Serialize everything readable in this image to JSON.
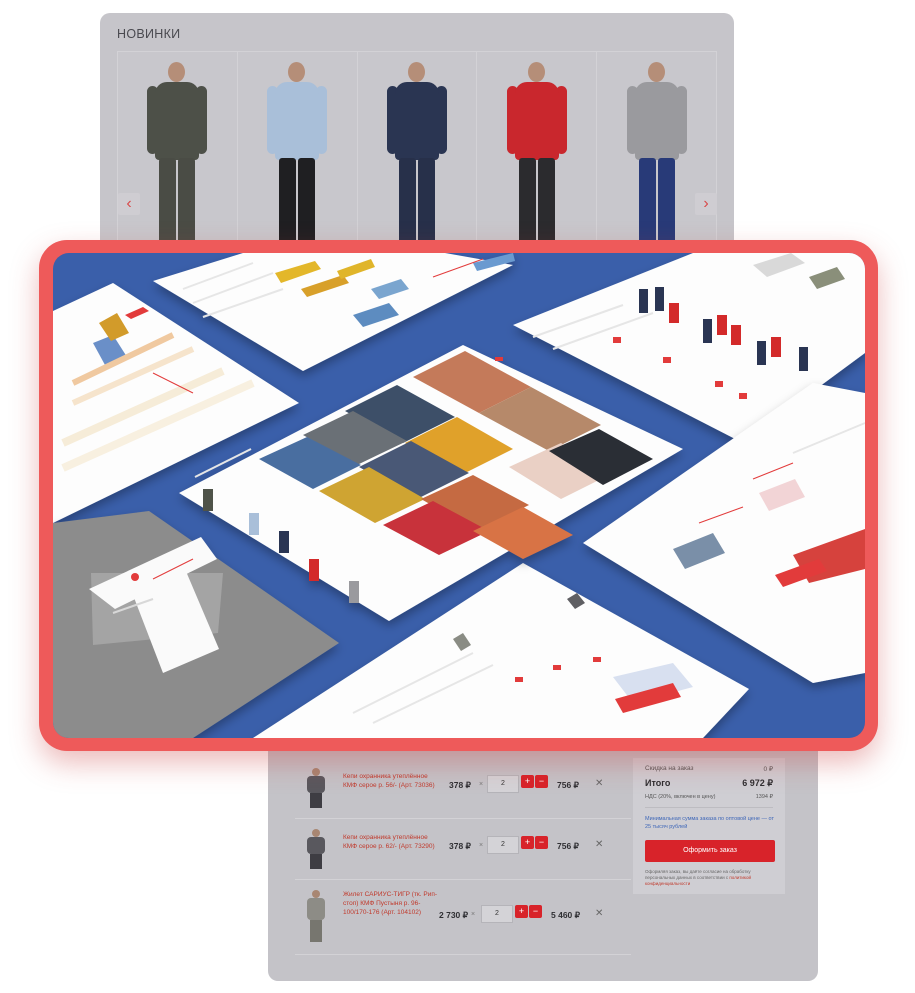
{
  "new_arrivals": {
    "title": "НОВИНКИ",
    "prev_icon": "chevron-left-icon",
    "next_icon": "chevron-right-icon",
    "products": [
      {
        "jacket": "#4d5048",
        "pants": "#4a4c45",
        "style": "camo"
      },
      {
        "jacket": "#a9bfd9",
        "pants": "#1f1f22",
        "style": "shirt"
      },
      {
        "jacket": "#2a3552",
        "pants": "#27304a",
        "style": "jacket"
      },
      {
        "jacket": "#c9272d",
        "pants": "#2b2b2e",
        "style": "jacket"
      },
      {
        "jacket": "#9a9a9e",
        "pants": "#283a78",
        "style": "tshirt"
      }
    ]
  },
  "cart": {
    "items": [
      {
        "name": "Кепи охранника утеплённое КМФ серое р. 56/- (Арт. 73036)",
        "price": "378 ₽",
        "times": "×",
        "qty": "2",
        "plus": "+",
        "minus": "−",
        "total": "756 ₽",
        "remove": "✕"
      },
      {
        "name": "Кепи охранника утеплённое КМФ серое р. 62/- (Арт. 73290)",
        "price": "378 ₽",
        "times": "×",
        "qty": "2",
        "plus": "+",
        "minus": "−",
        "total": "756 ₽",
        "remove": "✕"
      },
      {
        "name": "Жилет САРИУС-ТИГР (тк. Рип-стоп) КМФ Пустыня р. 96-100/170-176 (Арт. 104102)",
        "price": "2 730 ₽",
        "times": "×",
        "qty": "2",
        "plus": "+",
        "minus": "−",
        "total": "5 460 ₽",
        "remove": "✕"
      }
    ],
    "summary": {
      "discount_label": "Скидка на заказ",
      "discount_value": "0 ₽",
      "total_label": "Итого",
      "total_value": "6 972 ₽",
      "vat_label": "НДС (20%, включен в цену)",
      "vat_value": "1394 ₽",
      "min_sum": "Минимальная сумма заказа по оптовой цене — от 25 тысяч рублей",
      "order_button": "Оформить заказ",
      "note_prefix": "Оформляя заказ, вы даёте согласие на обработку персональных данных в соответствии с",
      "note_link": "политикой конфиденциальности"
    }
  },
  "colors": {
    "accent": "#d8232a",
    "frame": "#ee5a5a",
    "showcase_bg": "#3a5faa"
  }
}
